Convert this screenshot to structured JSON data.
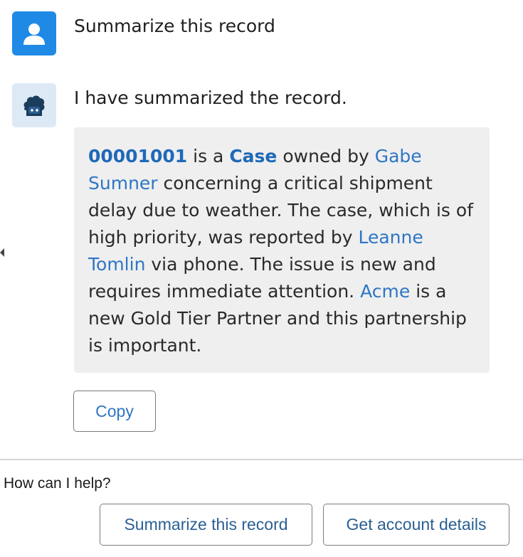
{
  "conversation": {
    "user_message": "Summarize this record",
    "bot_message": "I have summarized the record.",
    "summary": {
      "record_number": "00001001",
      "part1": " is a ",
      "record_type": "Case",
      "part2": " owned by ",
      "owner_name": "Gabe Sumner",
      "part3": " concerning a critical shipment delay due to weather. The case, which is of high priority, was reported by ",
      "reporter_name": "Leanne Tomlin",
      "part4": " via phone. The issue is new and requires immediate attention. ",
      "account_name": "Acme",
      "part5": " is a new Gold Tier Partner and this partnership is important."
    },
    "copy_label": "Copy"
  },
  "prompt": {
    "label": "How can I help?",
    "suggestions": [
      "Summarize this record",
      "Get account details"
    ]
  },
  "icons": {
    "user": "user-avatar-icon",
    "bot": "einstein-bot-icon",
    "collapse": "left-caret-icon"
  },
  "colors": {
    "user_avatar_bg": "#1f8ae6",
    "bot_avatar_bg": "#dde9f5",
    "link": "#2f76c4",
    "card_bg": "#efefef"
  }
}
